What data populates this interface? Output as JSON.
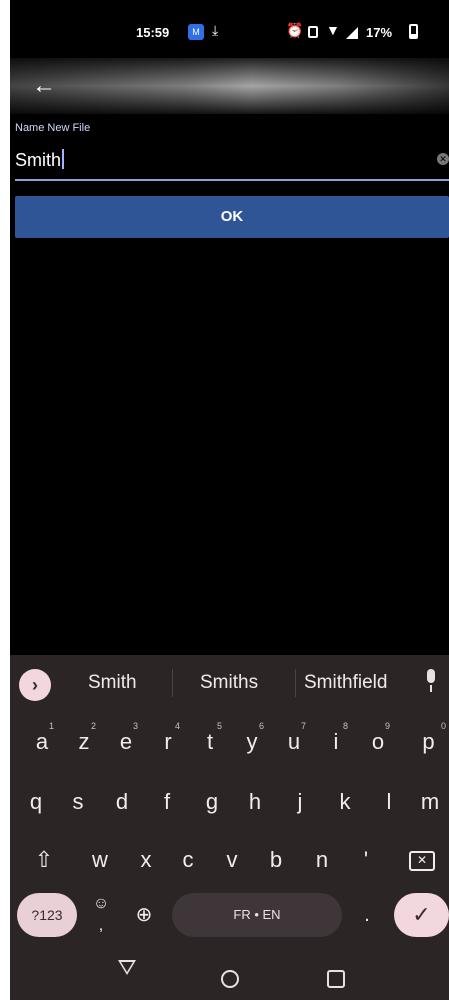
{
  "status_bar": {
    "time": "15:59",
    "battery_text": "17%"
  },
  "app_bar": {
    "back_icon": "←"
  },
  "form": {
    "label": "Name New File",
    "value": "Smith",
    "ok_label": "OK"
  },
  "keyboard": {
    "suggestions": [
      "Smith",
      "Smiths",
      "Smithfield"
    ],
    "row1": [
      {
        "k": "a",
        "h": "1"
      },
      {
        "k": "z",
        "h": "2"
      },
      {
        "k": "e",
        "h": "3"
      },
      {
        "k": "r",
        "h": "4"
      },
      {
        "k": "t",
        "h": "5"
      },
      {
        "k": "y",
        "h": "6"
      },
      {
        "k": "u",
        "h": "7"
      },
      {
        "k": "i",
        "h": "8"
      },
      {
        "k": "o",
        "h": "9"
      },
      {
        "k": "p",
        "h": "0"
      }
    ],
    "row2": [
      "q",
      "s",
      "d",
      "f",
      "g",
      "h",
      "j",
      "k",
      "l",
      "m"
    ],
    "row3": [
      "w",
      "x",
      "c",
      "v",
      "b",
      "n",
      "'"
    ],
    "num_label": "?123",
    "space_label": "FR • EN",
    "period": ".",
    "comma": ","
  },
  "icons": {
    "expand": "expand-icon",
    "mic": "microphone-icon",
    "shift": "shift-icon",
    "backspace": "backspace-icon",
    "emoji": "emoji-icon",
    "globe": "globe-icon",
    "enter": "checkmark-icon"
  }
}
